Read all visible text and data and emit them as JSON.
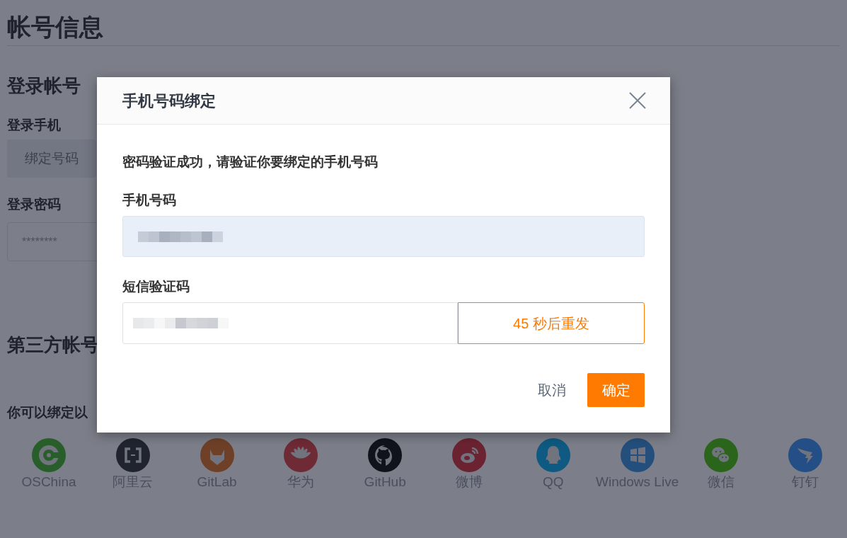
{
  "page": {
    "title": "帐号信息",
    "section_login": "登录帐号",
    "phone_label": "登录手机",
    "bind_button": "绑定号码",
    "password_label": "登录密码",
    "password_placeholder": "********",
    "section_third": "第三方帐号",
    "third_hint": "你可以绑定以"
  },
  "providers": [
    {
      "name": "OSChina",
      "kind": "oschina",
      "color": "#285e2a"
    },
    {
      "name": "阿里云",
      "kind": "aliyun",
      "color": "#20242e"
    },
    {
      "name": "GitLab",
      "kind": "gitlab",
      "color": "#6f4028"
    },
    {
      "name": "华为",
      "kind": "huawei",
      "color": "#6e2a35"
    },
    {
      "name": "GitHub",
      "kind": "github",
      "color": "#11131c"
    },
    {
      "name": "微博",
      "kind": "weibo",
      "color": "#6c2331"
    },
    {
      "name": "QQ",
      "kind": "qq",
      "color": "#0e5a82"
    },
    {
      "name": "Windows Live",
      "kind": "windows",
      "color": "#244f7c"
    },
    {
      "name": "微信",
      "kind": "wechat",
      "color": "#2a651b"
    },
    {
      "name": "钉钉",
      "kind": "dingtalk",
      "color": "#234f86"
    }
  ],
  "dialog": {
    "title": "手机号码绑定",
    "message": "密码验证成功，请验证你要绑定的手机号码",
    "phone_label": "手机号码",
    "code_label": "短信验证码",
    "resend": "45 秒后重发",
    "cancel": "取消",
    "confirm": "确定"
  }
}
